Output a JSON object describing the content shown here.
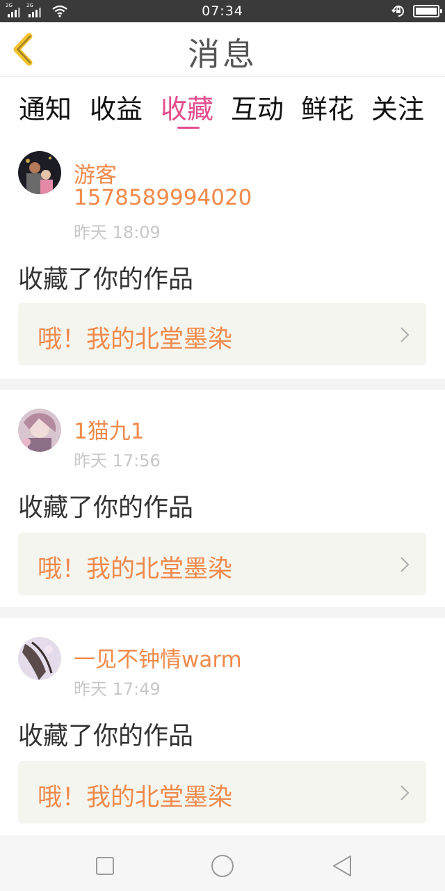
{
  "status_bar": {
    "network_tags": [
      "2G",
      "2G"
    ],
    "time": "07:34",
    "icons": [
      "signal-icon",
      "wifi-icon",
      "rotation-lock-icon",
      "battery-icon"
    ]
  },
  "header": {
    "title": "消息",
    "back_icon": "chevron-left-icon"
  },
  "tabs": [
    {
      "label": "通知",
      "active": false
    },
    {
      "label": "收益",
      "active": false
    },
    {
      "label": "收藏",
      "active": true
    },
    {
      "label": "互动",
      "active": false
    },
    {
      "label": "鲜花",
      "active": false
    },
    {
      "label": "关注",
      "active": false
    }
  ],
  "messages": [
    {
      "user": "游客",
      "user_id": "1578589994020",
      "time": "昨天 18:09",
      "action": "收藏了你的作品",
      "work_title": "哦！我的北堂墨染"
    },
    {
      "user": "1猫九1",
      "time": "昨天 17:56",
      "action": "收藏了你的作品",
      "work_title": "哦！我的北堂墨染"
    },
    {
      "user": "一见不钟情warm",
      "time": "昨天 17:49",
      "action": "收藏了你的作品",
      "work_title": "哦！我的北堂墨染"
    }
  ],
  "nav_bar": {
    "icons": [
      "recents-square-icon",
      "home-circle-icon",
      "back-triangle-icon"
    ]
  },
  "colors": {
    "accent": "#e54d8d",
    "name": "#f08a4b",
    "back_arrow": "#f2c230",
    "status_bar": "#3a3a3a"
  }
}
